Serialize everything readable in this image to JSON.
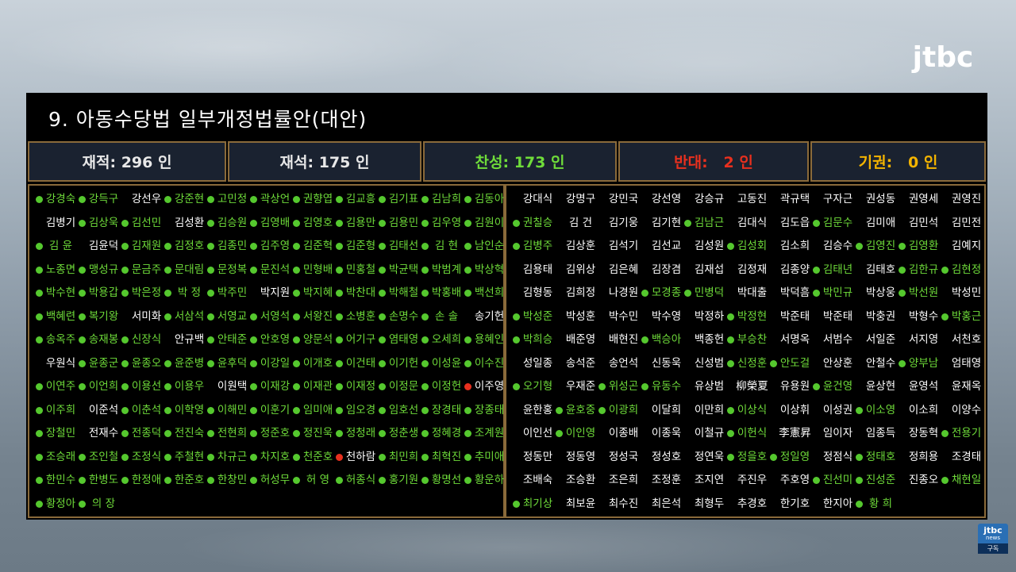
{
  "broadcaster": {
    "logo": "jtbc",
    "badge_top": "jtbc",
    "badge_mid": "news",
    "badge_bottom": "구독"
  },
  "bill_title": "9. 아동수당법 일부개정법률안(대안)",
  "stats": {
    "total": "재적: 296 인",
    "present": "재석: 175 인",
    "yes": "찬성: 173 인",
    "no": "반대:   2 인",
    "abstain": "기권:   0 인"
  },
  "colors": {
    "yes": "#6fdc3a",
    "no": "#e8301e",
    "abstain": "#f4b400",
    "neutral": "#ffffff",
    "frame": "#8a6a3a"
  },
  "left_rows": [
    [
      [
        "강경숙",
        "y"
      ],
      [
        "강득구",
        "y"
      ],
      [
        "강선우",
        ""
      ],
      [
        "강준현",
        "y"
      ],
      [
        "고민정",
        "y"
      ],
      [
        "곽상언",
        "y"
      ],
      [
        "권향엽",
        "y"
      ],
      [
        "김교흥",
        "y"
      ],
      [
        "김기표",
        "y"
      ],
      [
        "김남희",
        "y"
      ],
      [
        "김동아",
        "y"
      ]
    ],
    [
      [
        "김병기",
        ""
      ],
      [
        "김상욱",
        "y"
      ],
      [
        "김선민",
        "y"
      ],
      [
        "김성환",
        ""
      ],
      [
        "김승원",
        "y"
      ],
      [
        "김영배",
        "y"
      ],
      [
        "김영호",
        "y"
      ],
      [
        "김용만",
        "y"
      ],
      [
        "김용민",
        "y"
      ],
      [
        "김우영",
        "y"
      ],
      [
        "김원이",
        "y"
      ]
    ],
    [
      [
        "김 윤",
        "y"
      ],
      [
        "김윤덕",
        ""
      ],
      [
        "김재원",
        "y"
      ],
      [
        "김정호",
        "y"
      ],
      [
        "김종민",
        "y"
      ],
      [
        "김주영",
        "y"
      ],
      [
        "김준혁",
        "y"
      ],
      [
        "김준형",
        "y"
      ],
      [
        "김태선",
        "y"
      ],
      [
        "김 현",
        "y"
      ],
      [
        "남인순",
        "y"
      ]
    ],
    [
      [
        "노종면",
        "y"
      ],
      [
        "맹성규",
        "y"
      ],
      [
        "문금주",
        "y"
      ],
      [
        "문대림",
        "y"
      ],
      [
        "문정복",
        "y"
      ],
      [
        "문진석",
        "y"
      ],
      [
        "민형배",
        "y"
      ],
      [
        "민홍철",
        "y"
      ],
      [
        "박균택",
        "y"
      ],
      [
        "박범계",
        "y"
      ],
      [
        "박상혁",
        "y"
      ]
    ],
    [
      [
        "박수현",
        "y"
      ],
      [
        "박용갑",
        "y"
      ],
      [
        "박은정",
        "y"
      ],
      [
        "박 정",
        "y"
      ],
      [
        "박주민",
        "y"
      ],
      [
        "박지원",
        ""
      ],
      [
        "박지혜",
        "y"
      ],
      [
        "박찬대",
        "y"
      ],
      [
        "박해철",
        "y"
      ],
      [
        "박홍배",
        "y"
      ],
      [
        "백선희",
        "y"
      ]
    ],
    [
      [
        "백혜련",
        "y"
      ],
      [
        "복기왕",
        "y"
      ],
      [
        "서미화",
        ""
      ],
      [
        "서삼석",
        "y"
      ],
      [
        "서영교",
        "y"
      ],
      [
        "서영석",
        "y"
      ],
      [
        "서왕진",
        "y"
      ],
      [
        "소병훈",
        "y"
      ],
      [
        "손명수",
        "y"
      ],
      [
        "손 솔",
        "y"
      ],
      [
        "송기헌",
        ""
      ]
    ],
    [
      [
        "송옥주",
        "y"
      ],
      [
        "송재봉",
        "y"
      ],
      [
        "신장식",
        "y"
      ],
      [
        "안규백",
        ""
      ],
      [
        "안태준",
        "y"
      ],
      [
        "안호영",
        "y"
      ],
      [
        "양문석",
        "y"
      ],
      [
        "어기구",
        "y"
      ],
      [
        "염태영",
        "y"
      ],
      [
        "오세희",
        "y"
      ],
      [
        "용혜인",
        "y"
      ]
    ],
    [
      [
        "우원식",
        ""
      ],
      [
        "윤종군",
        "y"
      ],
      [
        "윤종오",
        "y"
      ],
      [
        "윤준병",
        "y"
      ],
      [
        "윤후덕",
        "y"
      ],
      [
        "이강일",
        "y"
      ],
      [
        "이개호",
        "y"
      ],
      [
        "이건태",
        "y"
      ],
      [
        "이기헌",
        "y"
      ],
      [
        "이성윤",
        "y"
      ],
      [
        "이수진",
        "y"
      ]
    ],
    [
      [
        "이연주",
        "y"
      ],
      [
        "이언희",
        "y"
      ],
      [
        "이용선",
        "y"
      ],
      [
        "이용우",
        "y"
      ],
      [
        "이원택",
        ""
      ],
      [
        "이재강",
        "y"
      ],
      [
        "이재관",
        "y"
      ],
      [
        "이재정",
        "y"
      ],
      [
        "이정문",
        "y"
      ],
      [
        "이정헌",
        "y"
      ],
      [
        "이주영",
        "n"
      ]
    ],
    [
      [
        "이주희",
        "y"
      ],
      [
        "이준석",
        ""
      ],
      [
        "이춘석",
        "y"
      ],
      [
        "이학영",
        "y"
      ],
      [
        "이해민",
        "y"
      ],
      [
        "이훈기",
        "y"
      ],
      [
        "임미애",
        "y"
      ],
      [
        "임오경",
        "y"
      ],
      [
        "임호선",
        "y"
      ],
      [
        "장경태",
        "y"
      ],
      [
        "장종태",
        "y"
      ]
    ],
    [
      [
        "장철민",
        "y"
      ],
      [
        "전재수",
        ""
      ],
      [
        "전종덕",
        "y"
      ],
      [
        "전진숙",
        "y"
      ],
      [
        "전현희",
        "y"
      ],
      [
        "정준호",
        "y"
      ],
      [
        "정진욱",
        "y"
      ],
      [
        "정청래",
        "y"
      ],
      [
        "정춘생",
        "y"
      ],
      [
        "정혜경",
        "y"
      ],
      [
        "조계원",
        "y"
      ]
    ],
    [
      [
        "조승래",
        "y"
      ],
      [
        "조인철",
        "y"
      ],
      [
        "조정식",
        "y"
      ],
      [
        "주철현",
        "y"
      ],
      [
        "차규근",
        "y"
      ],
      [
        "차지호",
        "y"
      ],
      [
        "천준호",
        "y"
      ],
      [
        "천하람",
        "n"
      ],
      [
        "최민희",
        "y"
      ],
      [
        "최혁진",
        "y"
      ],
      [
        "추미애",
        "y"
      ]
    ],
    [
      [
        "한민수",
        "y"
      ],
      [
        "한병도",
        "y"
      ],
      [
        "한정애",
        "y"
      ],
      [
        "한준호",
        "y"
      ],
      [
        "한창민",
        "y"
      ],
      [
        "허성무",
        "y"
      ],
      [
        "허 영",
        "y"
      ],
      [
        "허종식",
        "y"
      ],
      [
        "홍기원",
        "y"
      ],
      [
        "황명선",
        "y"
      ],
      [
        "황운하",
        "y"
      ]
    ],
    [
      [
        "황정아",
        "y"
      ],
      [
        "의 장",
        "y"
      ]
    ]
  ],
  "right_rows": [
    [
      [
        "강대식",
        ""
      ],
      [
        "강명구",
        ""
      ],
      [
        "강민국",
        ""
      ],
      [
        "강선영",
        ""
      ],
      [
        "강승규",
        ""
      ],
      [
        "고동진",
        ""
      ],
      [
        "곽규택",
        ""
      ],
      [
        "구자근",
        ""
      ],
      [
        "권성동",
        ""
      ],
      [
        "권영세",
        ""
      ],
      [
        "권영진",
        ""
      ]
    ],
    [
      [
        "권칠승",
        "y"
      ],
      [
        "김 건",
        ""
      ],
      [
        "김기웅",
        ""
      ],
      [
        "김기현",
        ""
      ],
      [
        "김남근",
        "y"
      ],
      [
        "김대식",
        ""
      ],
      [
        "김도읍",
        ""
      ],
      [
        "김문수",
        "y"
      ],
      [
        "김미애",
        ""
      ],
      [
        "김민석",
        ""
      ],
      [
        "김민전",
        ""
      ]
    ],
    [
      [
        "김병주",
        "y"
      ],
      [
        "김상훈",
        ""
      ],
      [
        "김석기",
        ""
      ],
      [
        "김선교",
        ""
      ],
      [
        "김성원",
        ""
      ],
      [
        "김성회",
        "y"
      ],
      [
        "김소희",
        ""
      ],
      [
        "김승수",
        ""
      ],
      [
        "김영진",
        "y"
      ],
      [
        "김영환",
        "y"
      ],
      [
        "김예지",
        ""
      ]
    ],
    [
      [
        "김용태",
        ""
      ],
      [
        "김위상",
        ""
      ],
      [
        "김은혜",
        ""
      ],
      [
        "김장겸",
        ""
      ],
      [
        "김재섭",
        ""
      ],
      [
        "김정재",
        ""
      ],
      [
        "김종양",
        ""
      ],
      [
        "김태년",
        "y"
      ],
      [
        "김태호",
        ""
      ],
      [
        "김한규",
        "y"
      ],
      [
        "김현정",
        "y"
      ]
    ],
    [
      [
        "김형동",
        ""
      ],
      [
        "김희정",
        ""
      ],
      [
        "나경원",
        ""
      ],
      [
        "모경종",
        "y"
      ],
      [
        "민병덕",
        "y"
      ],
      [
        "박대출",
        ""
      ],
      [
        "박덕흠",
        ""
      ],
      [
        "박민규",
        "y"
      ],
      [
        "박상웅",
        ""
      ],
      [
        "박선원",
        "y"
      ],
      [
        "박성민",
        ""
      ]
    ],
    [
      [
        "박성준",
        "y"
      ],
      [
        "박성훈",
        ""
      ],
      [
        "박수민",
        ""
      ],
      [
        "박수영",
        ""
      ],
      [
        "박정하",
        ""
      ],
      [
        "박정현",
        "y"
      ],
      [
        "박준태",
        ""
      ],
      [
        "박준태",
        ""
      ],
      [
        "박충권",
        ""
      ],
      [
        "박형수",
        ""
      ],
      [
        "박홍근",
        "y"
      ]
    ],
    [
      [
        "박희승",
        "y"
      ],
      [
        "배준영",
        ""
      ],
      [
        "배현진",
        ""
      ],
      [
        "백승아",
        "y"
      ],
      [
        "백종헌",
        ""
      ],
      [
        "부승찬",
        "y"
      ],
      [
        "서명옥",
        ""
      ],
      [
        "서범수",
        ""
      ],
      [
        "서일준",
        ""
      ],
      [
        "서지영",
        ""
      ],
      [
        "서천호",
        ""
      ]
    ],
    [
      [
        "성일종",
        ""
      ],
      [
        "송석준",
        ""
      ],
      [
        "송언석",
        ""
      ],
      [
        "신동욱",
        ""
      ],
      [
        "신성범",
        ""
      ],
      [
        "신정훈",
        "y"
      ],
      [
        "안도걸",
        "y"
      ],
      [
        "안상훈",
        ""
      ],
      [
        "안철수",
        ""
      ],
      [
        "양부남",
        "y"
      ],
      [
        "엄태영",
        ""
      ]
    ],
    [
      [
        "오기형",
        "y"
      ],
      [
        "우재준",
        ""
      ],
      [
        "위성곤",
        "y"
      ],
      [
        "유동수",
        "y"
      ],
      [
        "유상범",
        ""
      ],
      [
        "柳榮夏",
        ""
      ],
      [
        "유용원",
        ""
      ],
      [
        "윤건영",
        "y"
      ],
      [
        "윤상현",
        ""
      ],
      [
        "윤영석",
        ""
      ],
      [
        "윤재옥",
        ""
      ]
    ],
    [
      [
        "윤한홍",
        ""
      ],
      [
        "윤호중",
        "y"
      ],
      [
        "이광희",
        "y"
      ],
      [
        "이달희",
        ""
      ],
      [
        "이만희",
        ""
      ],
      [
        "이상식",
        "y"
      ],
      [
        "이상휘",
        ""
      ],
      [
        "이성권",
        ""
      ],
      [
        "이소영",
        "y"
      ],
      [
        "이소희",
        ""
      ],
      [
        "이양수",
        ""
      ]
    ],
    [
      [
        "이인선",
        ""
      ],
      [
        "이인영",
        "y"
      ],
      [
        "이종배",
        ""
      ],
      [
        "이종욱",
        ""
      ],
      [
        "이철규",
        ""
      ],
      [
        "이헌식",
        "y"
      ],
      [
        "李憲昇",
        ""
      ],
      [
        "임이자",
        ""
      ],
      [
        "임종득",
        ""
      ],
      [
        "장동혁",
        ""
      ],
      [
        "전용기",
        "y"
      ]
    ],
    [
      [
        "정동만",
        ""
      ],
      [
        "정동영",
        ""
      ],
      [
        "정성국",
        ""
      ],
      [
        "정성호",
        ""
      ],
      [
        "정연욱",
        ""
      ],
      [
        "정을호",
        "y"
      ],
      [
        "정일영",
        "y"
      ],
      [
        "정점식",
        ""
      ],
      [
        "정태호",
        "y"
      ],
      [
        "정희용",
        ""
      ],
      [
        "조경태",
        ""
      ]
    ],
    [
      [
        "조배숙",
        ""
      ],
      [
        "조승환",
        ""
      ],
      [
        "조은희",
        ""
      ],
      [
        "조정훈",
        ""
      ],
      [
        "조지연",
        ""
      ],
      [
        "주진우",
        ""
      ],
      [
        "주호영",
        ""
      ],
      [
        "진선미",
        "y"
      ],
      [
        "진성준",
        "y"
      ],
      [
        "진종오",
        ""
      ],
      [
        "채현일",
        "y"
      ]
    ],
    [
      [
        "최기상",
        "y"
      ],
      [
        "최보윤",
        ""
      ],
      [
        "최수진",
        ""
      ],
      [
        "최은석",
        ""
      ],
      [
        "최형두",
        ""
      ],
      [
        "추경호",
        ""
      ],
      [
        "한기호",
        ""
      ],
      [
        "한지아",
        ""
      ],
      [
        "황 희",
        "y"
      ]
    ]
  ]
}
